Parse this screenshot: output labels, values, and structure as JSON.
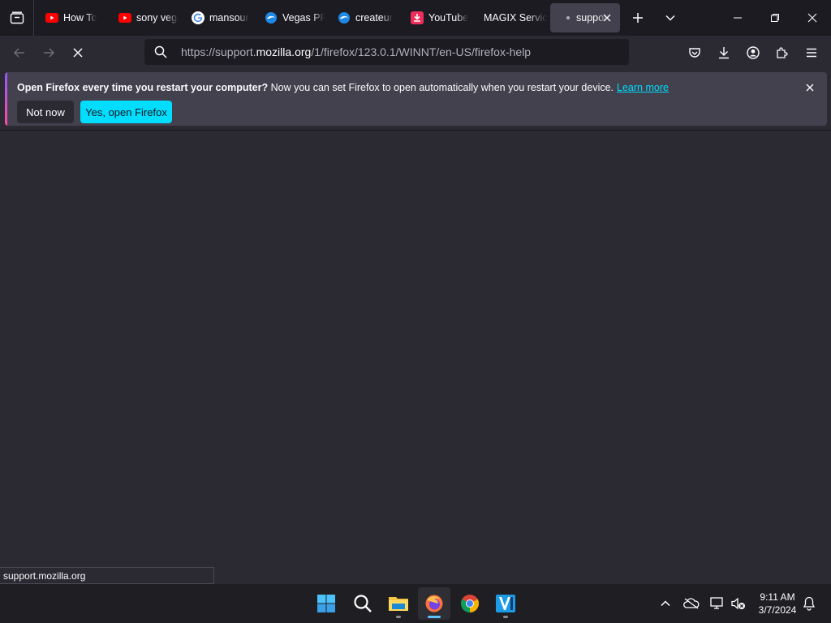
{
  "browser": {
    "tabs": [
      {
        "title": "How To",
        "icon": "youtube-icon"
      },
      {
        "title": "sony vegas",
        "icon": "youtube-icon"
      },
      {
        "title": "mansour",
        "icon": "google-icon"
      },
      {
        "title": "Vegas PRO",
        "icon": "edge-icon"
      },
      {
        "title": "createur",
        "icon": "edge-icon"
      },
      {
        "title": "YouTube",
        "icon": "download-icon"
      },
      {
        "title": "MAGIX Service",
        "icon": ""
      },
      {
        "title": "support",
        "icon": "loading-dot-icon",
        "active": true
      }
    ],
    "url": {
      "prefix": "https://support.",
      "domain": "mozilla.org",
      "suffix": "/1/firefox/123.0.1/WINNT/en-US/firefox-help"
    }
  },
  "notification": {
    "bold_text": "Open Firefox every time you restart your computer?",
    "text": " Now you can set Firefox to open automatically when you restart your device.",
    "link": "Learn more",
    "not_now": "Not now",
    "yes": "Yes, open Firefox"
  },
  "status_text": "support.mozilla.org",
  "taskbar": {
    "time": "9:11 AM",
    "date": "3/7/2024"
  },
  "colors": {
    "accent": "#00ddff",
    "background": "#2b2a33",
    "tabbar": "#1c1b22"
  }
}
